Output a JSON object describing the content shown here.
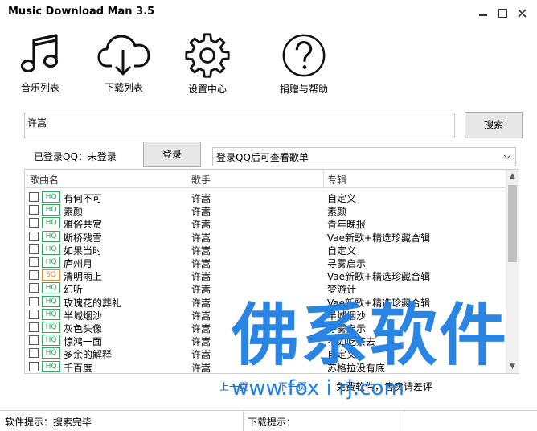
{
  "window": {
    "title": "Music Download Man 3.5"
  },
  "toolbar": {
    "items": [
      {
        "label": "音乐列表",
        "icon": "music-note-icon"
      },
      {
        "label": "下载列表",
        "icon": "cloud-download-icon"
      },
      {
        "label": "设置中心",
        "icon": "gear-icon"
      },
      {
        "label": "捐赠与帮助",
        "icon": "help-icon"
      }
    ]
  },
  "search": {
    "value": "许嵩",
    "button": "搜索"
  },
  "login": {
    "status": "已登录QQ：未登录",
    "button": "登录",
    "playlist_select": "登录QQ后可查看歌单"
  },
  "table": {
    "headers": [
      "歌曲名",
      "歌手",
      "专辑"
    ],
    "rows": [
      {
        "quality": "HQ",
        "song": "有何不可",
        "artist": "许嵩",
        "album": "自定义"
      },
      {
        "quality": "HQ",
        "song": "素颜",
        "artist": "许嵩",
        "album": "素颜"
      },
      {
        "quality": "HQ",
        "song": "雅俗共赏",
        "artist": "许嵩",
        "album": "青年晚报"
      },
      {
        "quality": "HQ",
        "song": "断桥残雪",
        "artist": "许嵩",
        "album": "Vae新歌+精选珍藏合辑"
      },
      {
        "quality": "HQ",
        "song": "如果当时",
        "artist": "许嵩",
        "album": "自定义"
      },
      {
        "quality": "HQ",
        "song": "庐州月",
        "artist": "许嵩",
        "album": "寻雾启示"
      },
      {
        "quality": "SQ",
        "song": "清明雨上",
        "artist": "许嵩",
        "album": "Vae新歌+精选珍藏合辑"
      },
      {
        "quality": "HQ",
        "song": "幻听",
        "artist": "许嵩",
        "album": "梦游计"
      },
      {
        "quality": "HQ",
        "song": "玫瑰花的葬礼",
        "artist": "许嵩",
        "album": "Vae新歌+精选珍藏合辑"
      },
      {
        "quality": "HQ",
        "song": "半城烟沙",
        "artist": "许嵩",
        "album": "半城烟沙"
      },
      {
        "quality": "HQ",
        "song": "灰色头像",
        "artist": "许嵩",
        "album": "寻雾启示"
      },
      {
        "quality": "HQ",
        "song": "惊鸿一面",
        "artist": "许嵩",
        "album": "不如吃茶去"
      },
      {
        "quality": "HQ",
        "song": "多余的解释",
        "artist": "许嵩",
        "album": "自定义"
      },
      {
        "quality": "HQ",
        "song": "千百度",
        "artist": "许嵩",
        "album": "苏格拉没有底"
      }
    ]
  },
  "pager": {
    "prev": "上一页",
    "next": "下一页",
    "note": "免费软件，售卖请差评"
  },
  "watermark": {
    "text": "佛系软件",
    "url": "www.fox i rj.com"
  },
  "statusbar": {
    "software": "软件提示：搜索完毕",
    "download": "下载提示："
  },
  "colors": {
    "badge_hq": "#3aa55c",
    "badge_sq": "#e08a2c",
    "watermark": "#1e7fe0"
  }
}
